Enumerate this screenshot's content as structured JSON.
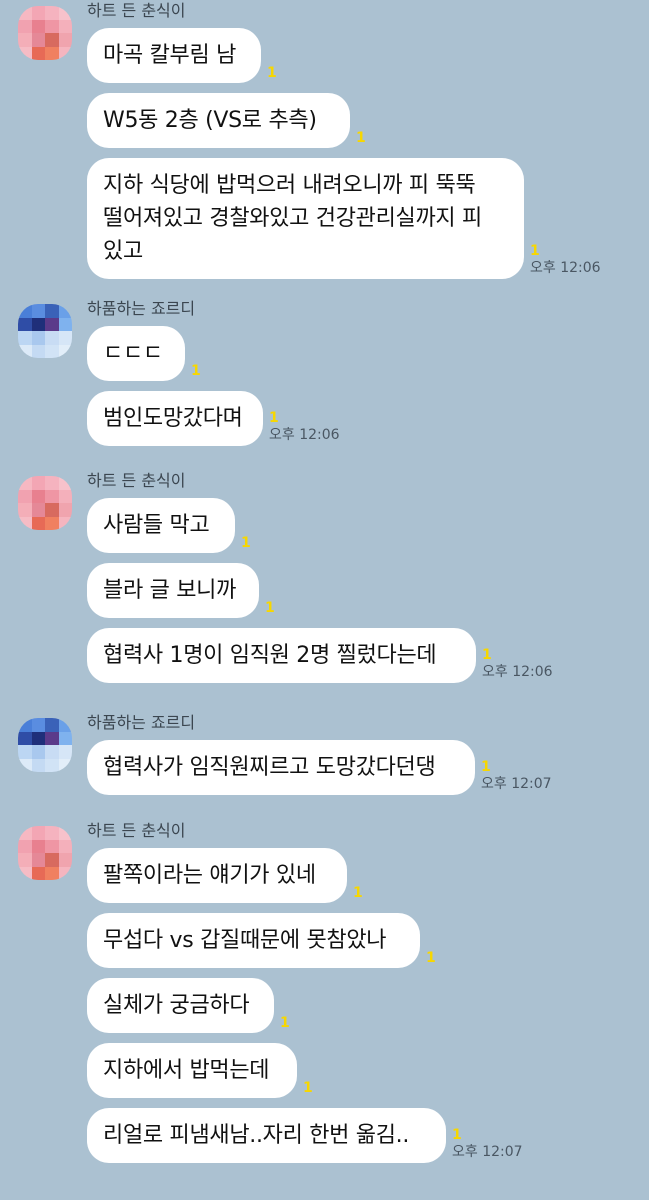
{
  "colors": {
    "background": "#abc1d1",
    "bubble": "#ffffff",
    "unread": "#f7d700"
  },
  "groups": [
    {
      "sender": "하트 든 춘식이",
      "avatar": "pink-avatar",
      "messages": [
        {
          "text": "마곡 칼부림 남",
          "unread": "1",
          "time": ""
        },
        {
          "text": "W5동 2층 (VS로 추측)",
          "unread": "1",
          "time": ""
        },
        {
          "text": "지하 식당에 밥먹으러 내려오니까 피 뚝뚝 떨어져있고 경찰와있고 건강관리실까지 피 있고",
          "unread": "1",
          "time": "오후 12:06"
        }
      ]
    },
    {
      "sender": "하품하는 죠르디",
      "avatar": "blue-avatar",
      "messages": [
        {
          "text": "ㄷㄷㄷ",
          "unread": "1",
          "time": ""
        },
        {
          "text": "범인도망갔다며",
          "unread": "1",
          "time": "오후 12:06"
        }
      ]
    },
    {
      "sender": "하트 든 춘식이",
      "avatar": "pink-avatar",
      "messages": [
        {
          "text": "사람들 막고",
          "unread": "1",
          "time": ""
        },
        {
          "text": "블라 글 보니까",
          "unread": "1",
          "time": ""
        },
        {
          "text": "협력사 1명이 임직원 2명 찔렀다는데",
          "unread": "1",
          "time": "오후 12:06"
        }
      ]
    },
    {
      "sender": "하품하는 죠르디",
      "avatar": "blue-avatar",
      "messages": [
        {
          "text": "협력사가 임직원찌르고 도망갔다던댕",
          "unread": "1",
          "time": "오후 12:07"
        }
      ]
    },
    {
      "sender": "하트 든 춘식이",
      "avatar": "pink-avatar",
      "messages": [
        {
          "text": "팔쪽이라는 얘기가 있네",
          "unread": "1",
          "time": ""
        },
        {
          "text": "무섭다 vs 갑질때문에 못참았나",
          "unread": "1",
          "time": ""
        },
        {
          "text": "실체가 궁금하다",
          "unread": "1",
          "time": ""
        },
        {
          "text": "지하에서 밥먹는데",
          "unread": "1",
          "time": ""
        },
        {
          "text": "리얼로 피냄새남..자리 한번 옮김..",
          "unread": "1",
          "time": "오후 12:07"
        }
      ]
    }
  ]
}
